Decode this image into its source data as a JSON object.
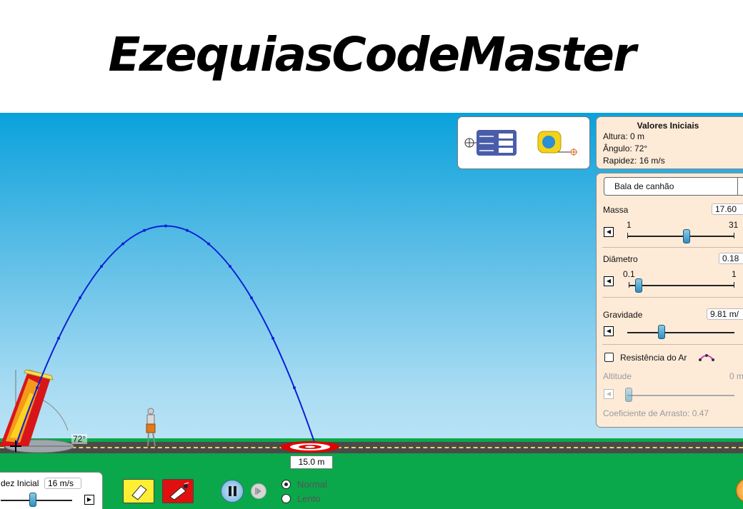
{
  "banner": {
    "title": "EzequiasCodeMaster"
  },
  "initial_values": {
    "title": "Valores Iniciais",
    "height": "Altura: 0 m",
    "angle": "Ângulo: 72°",
    "speed": "Rapidez: 16 m/s"
  },
  "projectile": {
    "selected": "Bala de canhão",
    "mass": {
      "label": "Massa",
      "value": "17.60",
      "min": "1",
      "max": "31",
      "level": 0.55
    },
    "diameter": {
      "label": "Diâmetro",
      "value": "0.18",
      "min": "0.1",
      "max": "1",
      "level": 0.09
    },
    "gravity": {
      "label": "Gravidade",
      "value": "9.81 m/",
      "level": 0.32
    },
    "air_resistance": {
      "label": "Resistência do Ar",
      "checked": false
    },
    "altitude": {
      "label": "Altitude",
      "value": "0 m",
      "level": 0.0
    },
    "drag_coefficient": "Coeficiente de Arrasto: 0.47"
  },
  "launch": {
    "angle_label": "72°",
    "distance_readout": "15.0 m",
    "speed_label": "dez Inicial",
    "speed_value": "16 m/s"
  },
  "playback": {
    "speed_options": [
      "Normal",
      "Lento"
    ],
    "selected": "Normal"
  },
  "colors": {
    "trajectory": "#0b1fd6",
    "target_red": "#e00000",
    "eraser_bg": "#ffee33",
    "fire_bg": "#e01010"
  },
  "icons": {
    "eraser": "eraser-icon",
    "fire": "cannon-fire-icon",
    "pause": "pause-icon",
    "step": "step-forward-icon",
    "tape": "tape-measure-icon",
    "stopwatch": "data-probe-icon"
  }
}
